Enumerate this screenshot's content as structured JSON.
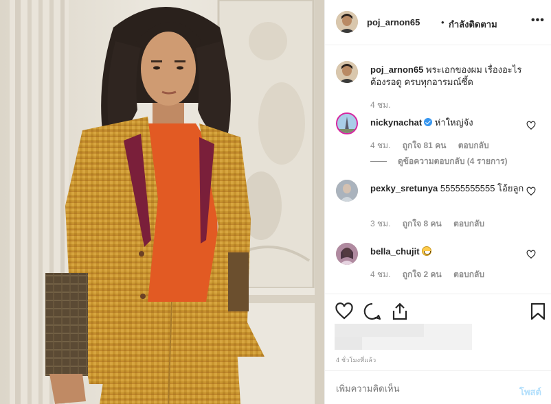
{
  "post": {
    "author": "poj_arnon65",
    "dot": "•",
    "follow_status": "กำลังติดตาม",
    "more_icon": "more-options-icon",
    "more_glyph": "•••"
  },
  "comments": [
    {
      "username": "poj_arnon65",
      "text": "พระเอกของผม เรื่องอะไรต้องรอดู ครบทุกอารมณ์ซึ้ด",
      "time": "4 ชม.",
      "likes": "",
      "reply": ""
    },
    {
      "username": "nickynachat",
      "verified": true,
      "text": "ห่าใหญ่จัง",
      "time": "4 ชม.",
      "likes": "ถูกใจ 81 คน",
      "reply": "ตอบกลับ",
      "view_replies": "ดูข้อความตอบกลับ (4 รายการ)"
    },
    {
      "username": "pexky_sretunya",
      "text": "55555555555 โอ้ยลูก",
      "time": "3 ชม.",
      "likes": "ถูกใจ 8 คน",
      "reply": "ตอบกลับ"
    },
    {
      "username": "bella_chujit",
      "text": "",
      "emoji": "grinning-face-emoji",
      "time": "4 ชม.",
      "likes": "ถูกใจ 2 คน",
      "reply": "ตอบกลับ"
    }
  ],
  "actions": {
    "like_icon": "heart-icon",
    "comment_icon": "comment-icon",
    "share_icon": "share-icon",
    "save_icon": "bookmark-icon"
  },
  "time_ago": "4 ชั่วโมงที่แล้ว",
  "add_comment": {
    "placeholder": "เพิ่มความคิดเห็น",
    "post_label": "โพสต์"
  },
  "colors": {
    "text": "#262626",
    "muted": "#8e8e8e",
    "link_disabled": "#b2dffc",
    "verified": "#3897f0"
  }
}
